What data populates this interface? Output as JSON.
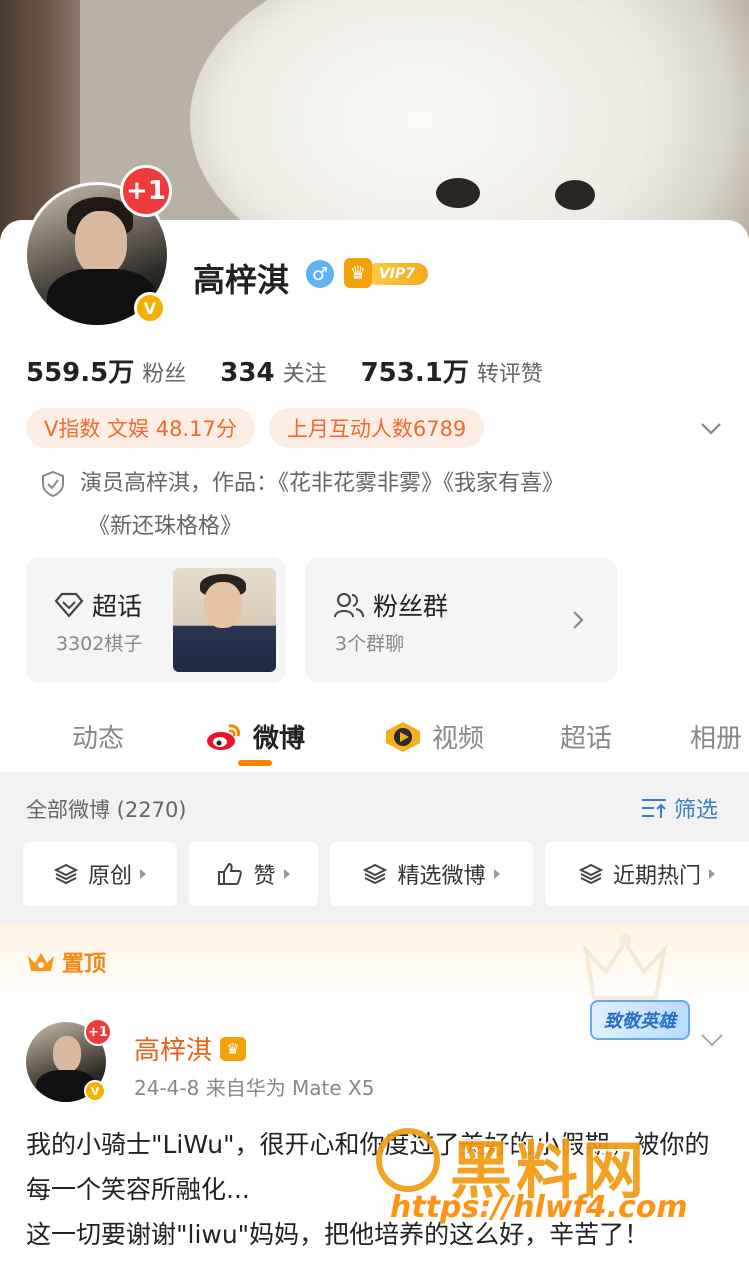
{
  "profile": {
    "badge_plus": "+1",
    "badge_v": "V",
    "name": "高梓淇",
    "gender_symbol": "♂",
    "vip_label": "VIP7",
    "stats": [
      {
        "num": "559.5",
        "unit": "万",
        "label": "粉丝"
      },
      {
        "num": "334",
        "unit": "",
        "label": "关注"
      },
      {
        "num": "753.1",
        "unit": "万",
        "label": "转评赞"
      }
    ],
    "pills": [
      "V指数 文娱 48.17分",
      "上月互动人数6789"
    ],
    "intro_line1": "演员高梓淇，作品：《花非花雾非雾》《我家有喜》",
    "intro_line2": "《新还珠格格》"
  },
  "boxes": {
    "topic": {
      "title": "超话",
      "sub": "3302棋子"
    },
    "fans": {
      "title": "粉丝群",
      "sub": "3个群聊"
    }
  },
  "tabs": [
    "动态",
    "微博",
    "视频",
    "超话",
    "相册"
  ],
  "active_tab": "微博",
  "filter": {
    "all_count": "全部微博 (2270)",
    "filter_label": "筛选",
    "chips": [
      "原创",
      "赞",
      "精选微博",
      "近期热门"
    ]
  },
  "pinned": {
    "label": "置顶",
    "hero_badge": "致敬英雄"
  },
  "post": {
    "plus": "+1",
    "v": "V",
    "name": "高梓淇",
    "meta": "24-4-8  来自华为 Mate X5",
    "text": "我的小骑士\"LiWu\"，很开心和你度过了美好的小假期，被你的每一个笑容所融化...\n这一切要谢谢\"liwu\"妈妈，把他培养的这么好，辛苦了！"
  },
  "watermark": {
    "text": "黑料网",
    "url": "https://hlwf4.com"
  },
  "colors": {
    "accent": "#ff8200",
    "pill_text": "#ef6a2c",
    "link_blue": "#3d7cc9",
    "vip_gold": "#f2a20c"
  }
}
